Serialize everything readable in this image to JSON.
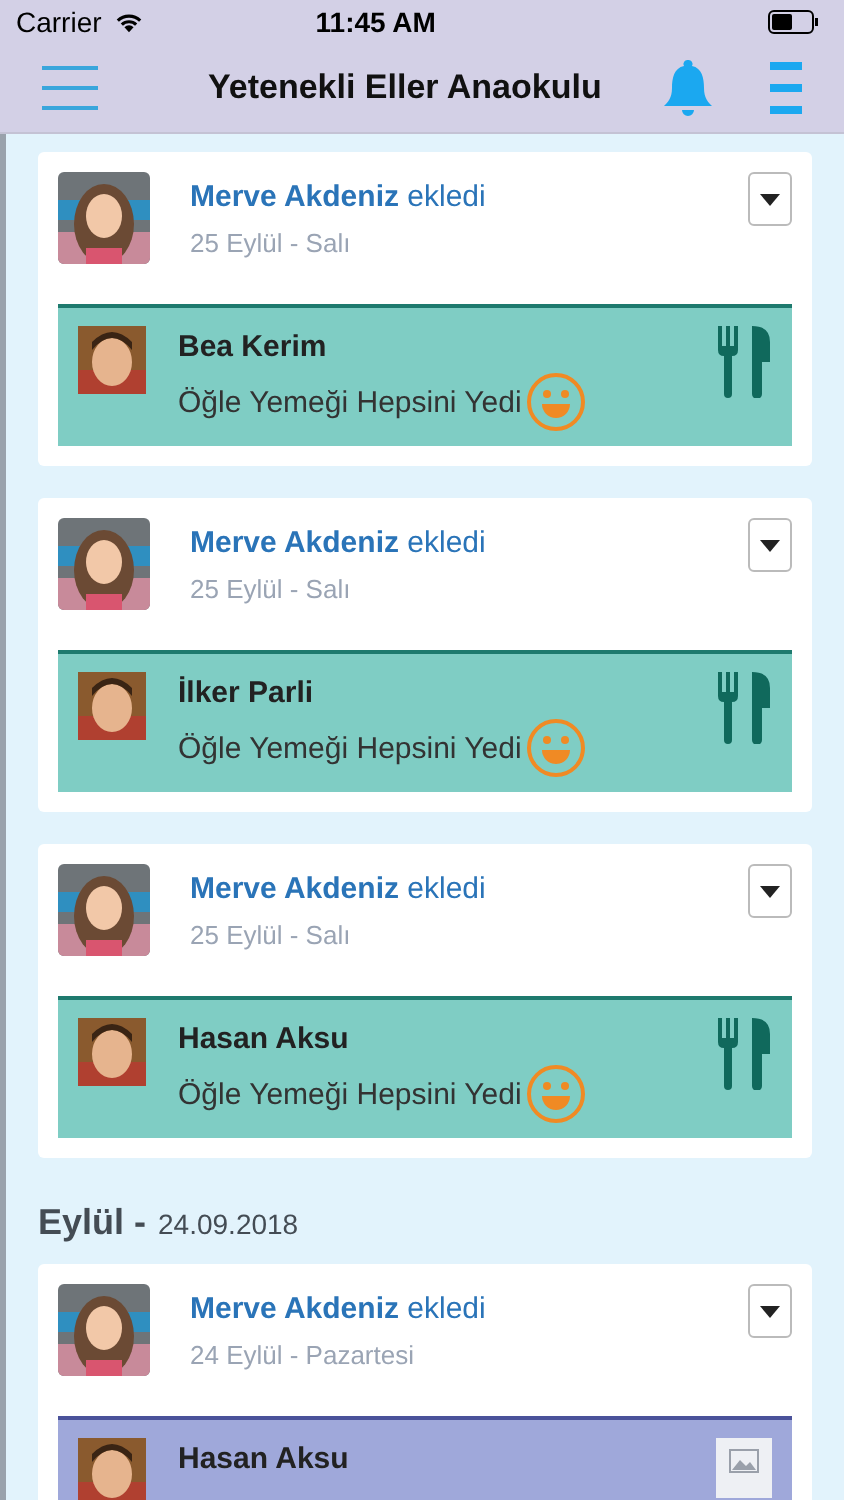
{
  "status_bar": {
    "carrier": "Carrier",
    "time": "11:45 AM"
  },
  "nav": {
    "title": "Yetenekli Eller Anaokulu"
  },
  "feed": [
    {
      "kind": "post",
      "author": "Merve Akdeniz",
      "action": "ekledi",
      "date": "25 Eylül - Salı",
      "activity": {
        "kind": "meal",
        "child": "Bea Kerim",
        "text": "Öğle Yemeği Hepsini Yedi"
      }
    },
    {
      "kind": "post",
      "author": "Merve Akdeniz",
      "action": "ekledi",
      "date": "25 Eylül - Salı",
      "activity": {
        "kind": "meal",
        "child": "İlker Parli",
        "text": "Öğle Yemeği Hepsini Yedi"
      }
    },
    {
      "kind": "post",
      "author": "Merve Akdeniz",
      "action": "ekledi",
      "date": "25 Eylül - Salı",
      "activity": {
        "kind": "meal",
        "child": "Hasan Aksu",
        "text": "Öğle Yemeği Hepsini Yedi"
      }
    },
    {
      "kind": "date_header",
      "month": "Eylül -",
      "date": "24.09.2018"
    },
    {
      "kind": "post",
      "author": "Merve Akdeniz",
      "action": "ekledi",
      "date": "24 Eylül - Pazartesi",
      "activity": {
        "child": "Hasan Aksu"
      }
    }
  ]
}
